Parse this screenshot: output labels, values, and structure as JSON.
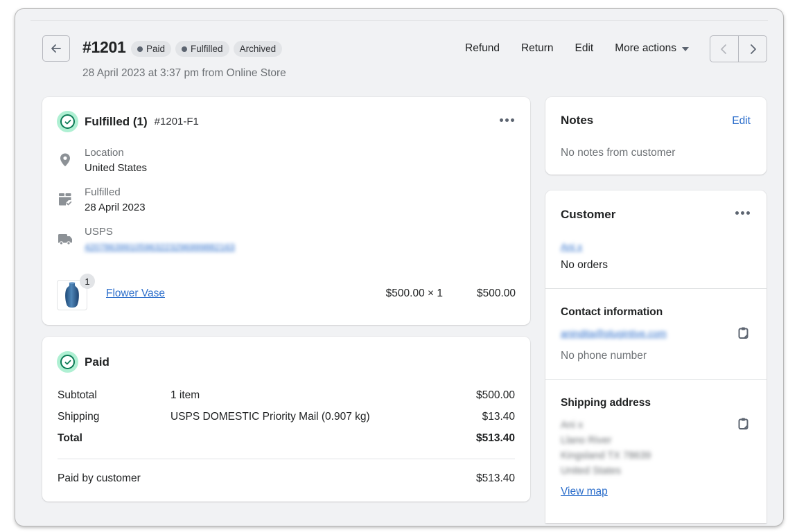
{
  "header": {
    "order_number": "#1201",
    "badges": [
      {
        "label": "Paid",
        "dot": true
      },
      {
        "label": "Fulfilled",
        "dot": true
      },
      {
        "label": "Archived",
        "dot": false
      }
    ],
    "subtitle": "28 April 2023 at 3:37 pm from Online Store",
    "actions": {
      "refund": "Refund",
      "return": "Return",
      "edit": "Edit",
      "more_actions": "More actions"
    }
  },
  "fulfillment": {
    "title": "Fulfilled (1)",
    "id": "#1201-F1",
    "location_label": "Location",
    "location_value": "United States",
    "fulfilled_label": "Fulfilled",
    "fulfilled_date": "28 April 2023",
    "carrier_label": "USPS",
    "tracking_number": "420786399105963223296999882163",
    "product": {
      "name": "Flower Vase",
      "quantity_badge": "1",
      "unit_price": "$500.00 × 1",
      "line_total": "$500.00"
    }
  },
  "payment": {
    "title": "Paid",
    "rows": [
      {
        "label": "Subtotal",
        "detail": "1 item",
        "amount": "$500.00"
      },
      {
        "label": "Shipping",
        "detail": "USPS DOMESTIC Priority Mail (0.907 kg)",
        "amount": "$13.40"
      },
      {
        "label": "Total",
        "detail": "",
        "amount": "$513.40"
      }
    ],
    "paid_by_label": "Paid by customer",
    "paid_by_amount": "$513.40"
  },
  "notes": {
    "title": "Notes",
    "edit_label": "Edit",
    "text": "No notes from customer"
  },
  "customer": {
    "title": "Customer",
    "name": "Ani x",
    "orders": "No orders",
    "contact_title": "Contact information",
    "email": "anindita@plugintive.com",
    "phone": "No phone number",
    "shipping_title": "Shipping address",
    "address_lines": [
      "Ani x",
      "Llano River",
      "Kingsland TX 78639",
      "United States"
    ],
    "view_map": "View map"
  },
  "colors": {
    "link": "#2c6ecb",
    "success_bg": "#aff0d3",
    "success": "#0b7a55",
    "page_bg": "#f1f2f4"
  }
}
